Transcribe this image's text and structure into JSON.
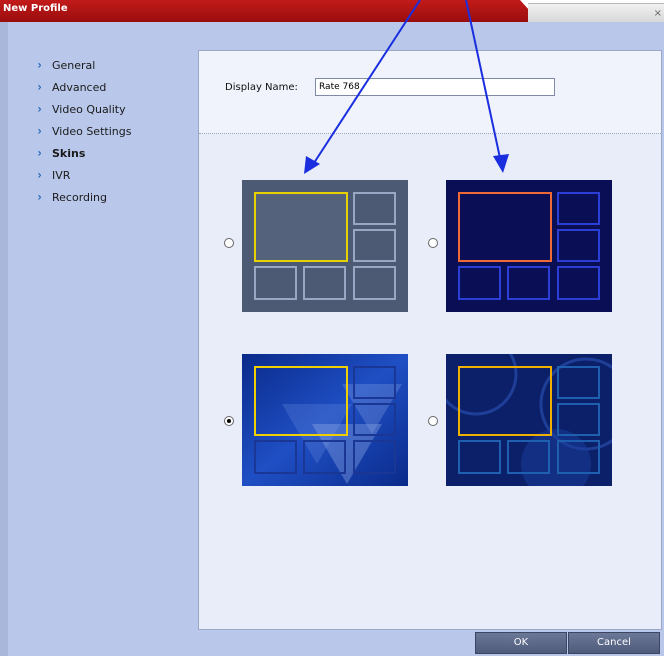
{
  "window": {
    "title": "New Profile",
    "close_glyph": "×"
  },
  "sidebar": {
    "items": [
      {
        "label": "General",
        "icon": "chevron-right-icon"
      },
      {
        "label": "Advanced",
        "icon": "chevron-right-icon"
      },
      {
        "label": "Video Quality",
        "icon": "chevron-right-icon"
      },
      {
        "label": "Video Settings",
        "icon": "chevron-right-icon"
      },
      {
        "label": "Skins",
        "icon": "chevron-right-icon",
        "active": true
      },
      {
        "label": "IVR",
        "icon": "chevron-right-icon"
      },
      {
        "label": "Recording",
        "icon": "chevron-right-icon"
      }
    ],
    "arrow_glyph": "›"
  },
  "form": {
    "display_name_label": "Display Name:",
    "display_name_value": "Rate 768"
  },
  "skins": {
    "options": [
      {
        "name": "skin-gray",
        "selected": false,
        "frame_accent": "#e8d200"
      },
      {
        "name": "skin-dark-navy",
        "selected": false,
        "frame_accent": "#f06a36"
      },
      {
        "name": "skin-blue-triangles",
        "selected": true,
        "frame_accent": "#f0d000"
      },
      {
        "name": "skin-blue-circles",
        "selected": false,
        "frame_accent": "#f0b000"
      }
    ]
  },
  "annotation": {
    "arrow_color": "#1a2ee0"
  },
  "footer": {
    "ok_label": "OK",
    "cancel_label": "Cancel"
  },
  "colors": {
    "title_bar": "#b01414",
    "dialog_bg": "#b9c8ea",
    "panel_bg": "#e8edf9",
    "button_bg": "#5a6787"
  }
}
